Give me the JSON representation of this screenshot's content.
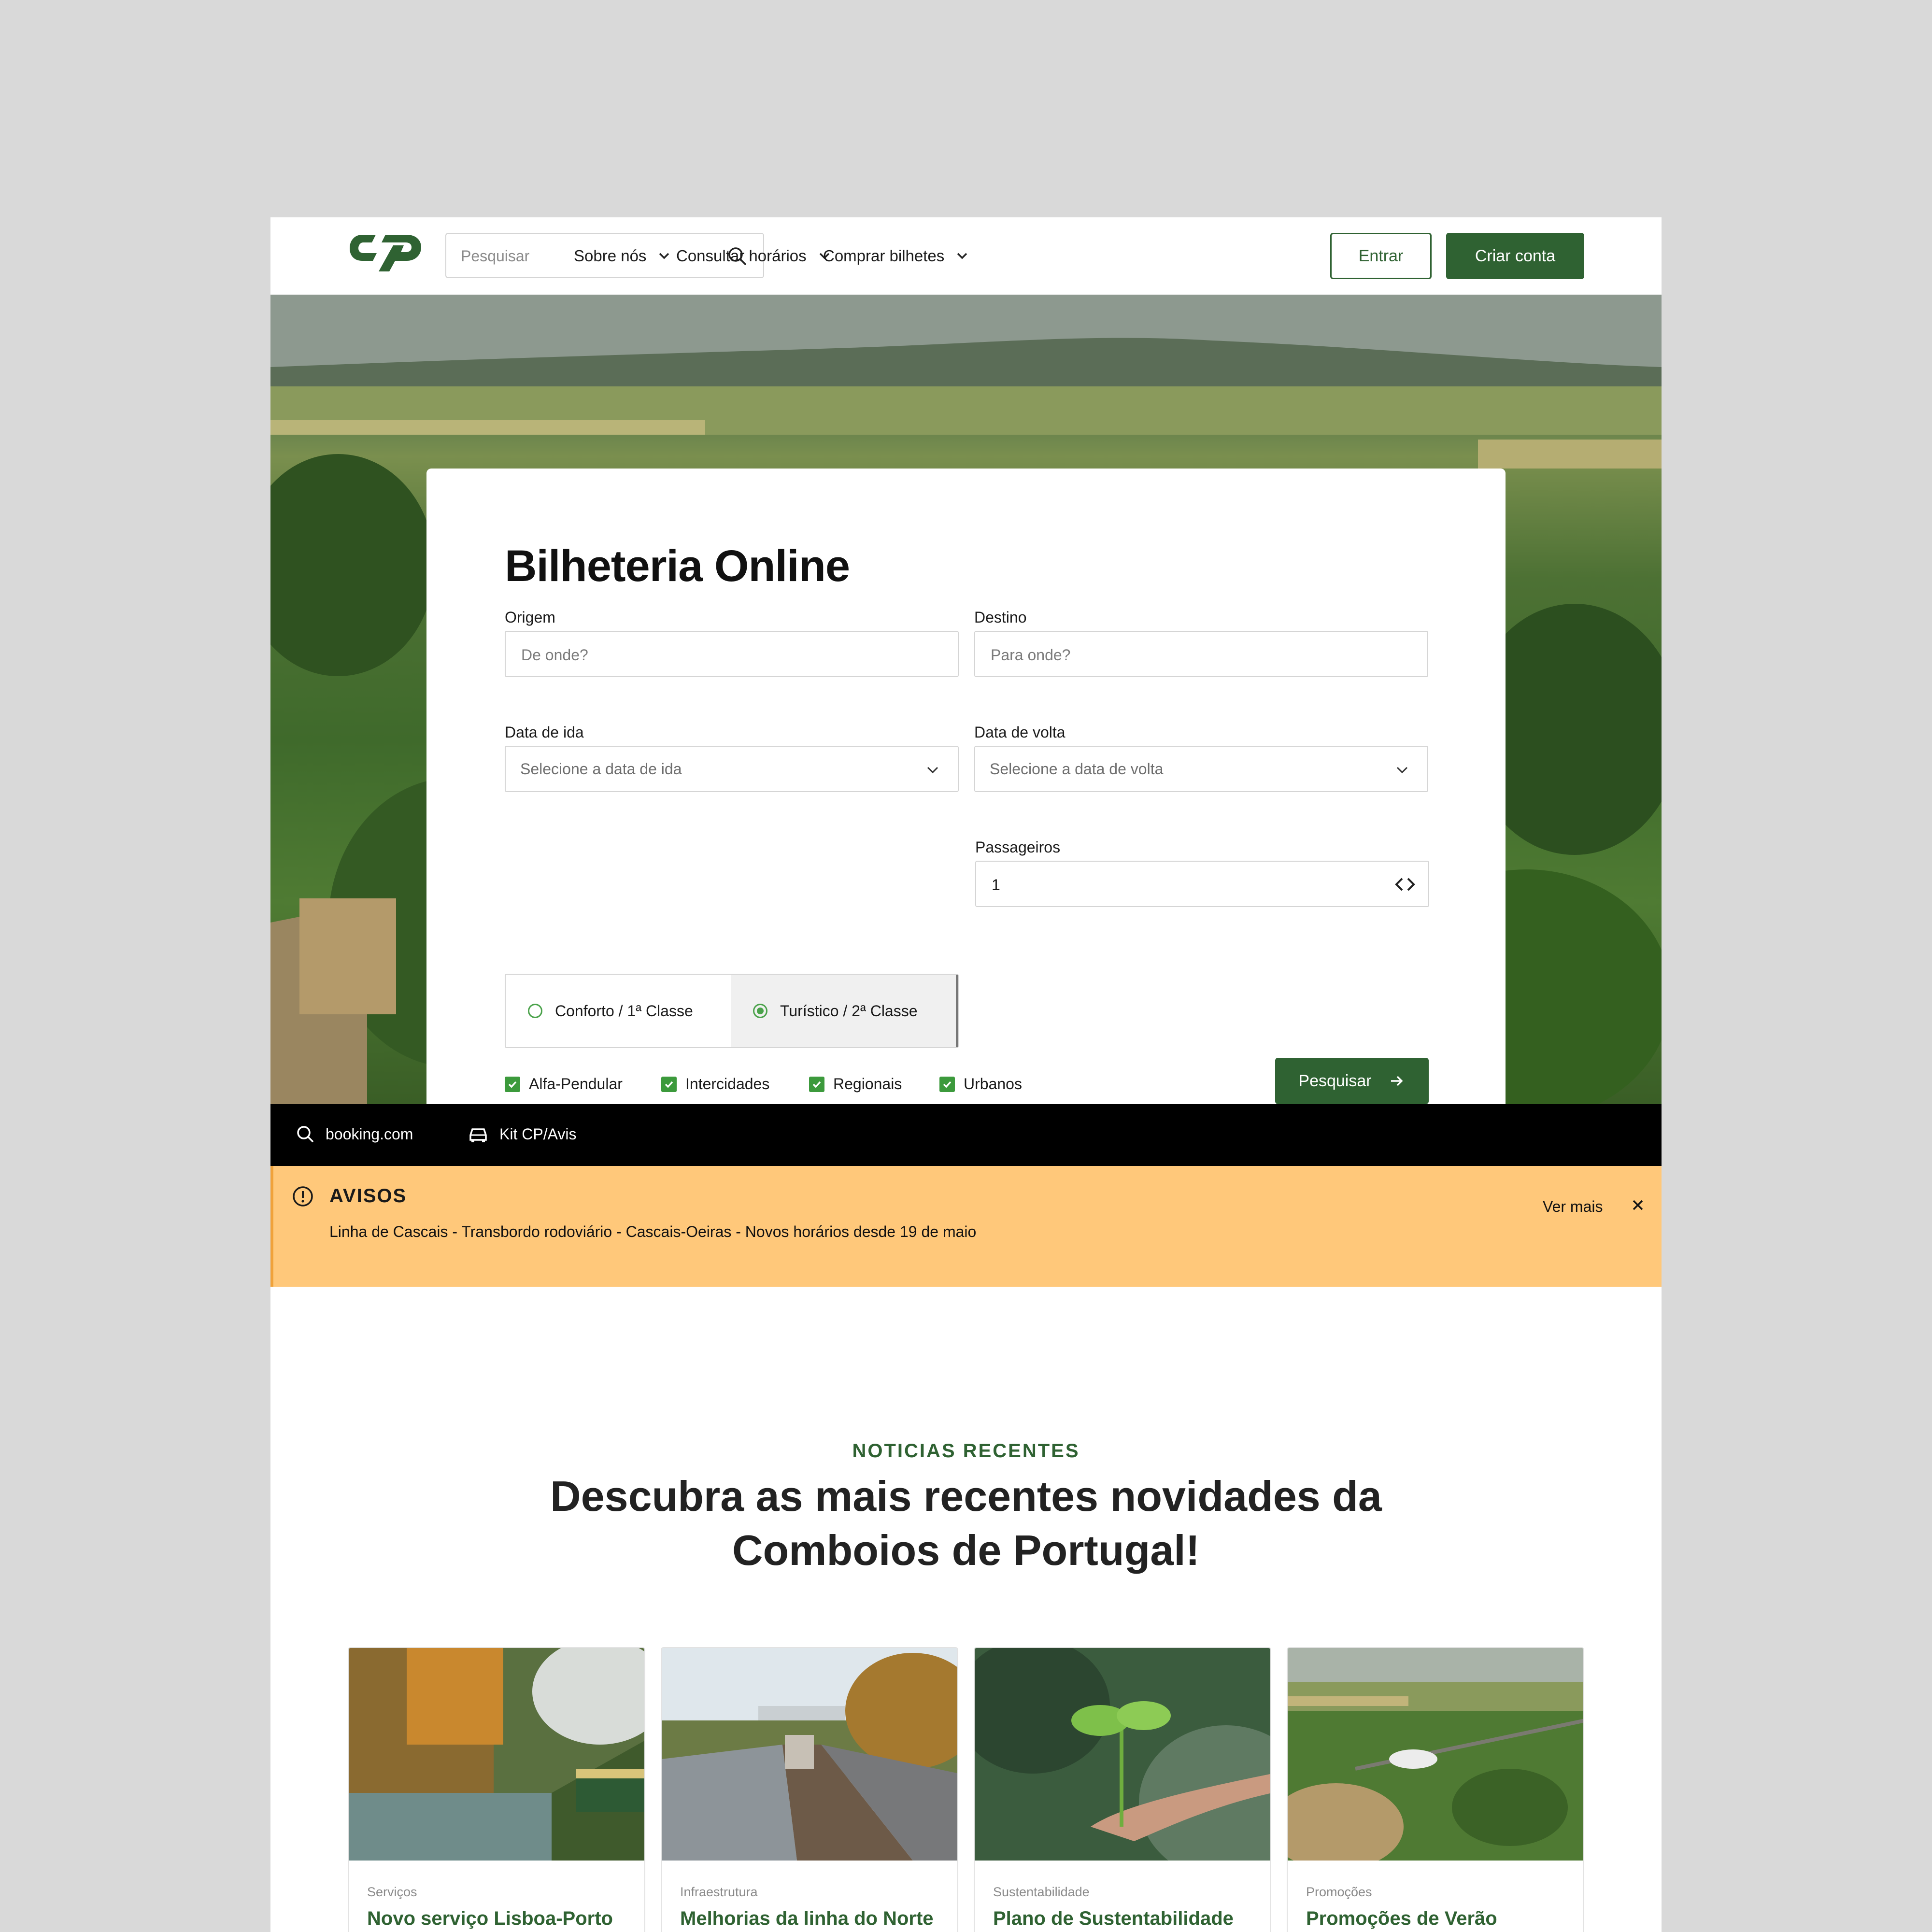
{
  "header": {
    "search_placeholder": "Pesquisar",
    "nav": [
      {
        "label": "Sobre nós"
      },
      {
        "label": "Consultar horários"
      },
      {
        "label": "Comprar bilhetes"
      }
    ],
    "login_label": "Entrar",
    "signup_label": "Criar conta"
  },
  "booking": {
    "title": "Bilheteria Online",
    "origin_label": "Origem",
    "origin_placeholder": "De onde?",
    "destination_label": "Destino",
    "destination_placeholder": "Para onde?",
    "departure_label": "Data de ida",
    "departure_placeholder": "Selecione a data de ida",
    "return_label": "Data de volta",
    "return_placeholder": "Selecione a data de volta",
    "classes": [
      {
        "label": "Conforto / 1ª Classe",
        "selected": false
      },
      {
        "label": "Turístico / 2ª Classe",
        "selected": true
      }
    ],
    "passengers_label": "Passageiros",
    "passengers_value": "1",
    "train_types": [
      {
        "label": "Alfa-Pendular",
        "checked": true
      },
      {
        "label": "Intercidades",
        "checked": true
      },
      {
        "label": "Regionais",
        "checked": true
      },
      {
        "label": "Urbanos",
        "checked": true
      }
    ],
    "search_label": "Pesquisar"
  },
  "partners": [
    {
      "label": "booking.com",
      "icon": "search-icon"
    },
    {
      "label": "Kit CP/Avis",
      "icon": "car-icon"
    }
  ],
  "notice": {
    "title": "AVISOS",
    "message": "Linha de Cascais - Transbordo rodoviário - Cascais-Oeiras - Novos horários desde 19 de maio",
    "more_label": "Ver mais"
  },
  "news": {
    "eyebrow": "NOTICIAS RECENTES",
    "title": "Descubra as mais recentes novidades da Comboios de Portugal!",
    "items": [
      {
        "category": "Serviços",
        "title": "Novo serviço Lisboa-Porto"
      },
      {
        "category": "Infraestrutura",
        "title": "Melhorias da linha do Norte"
      },
      {
        "category": "Sustentabilidade",
        "title": "Plano de Sustentabilidade"
      },
      {
        "category": "Promoções",
        "title": "Promoções de Verão"
      }
    ]
  },
  "colors": {
    "brand_green": "#2f6232",
    "check_green": "#3c9a3c",
    "notice_bg": "#ffc87a",
    "page_bg": "#d9d9d9"
  }
}
